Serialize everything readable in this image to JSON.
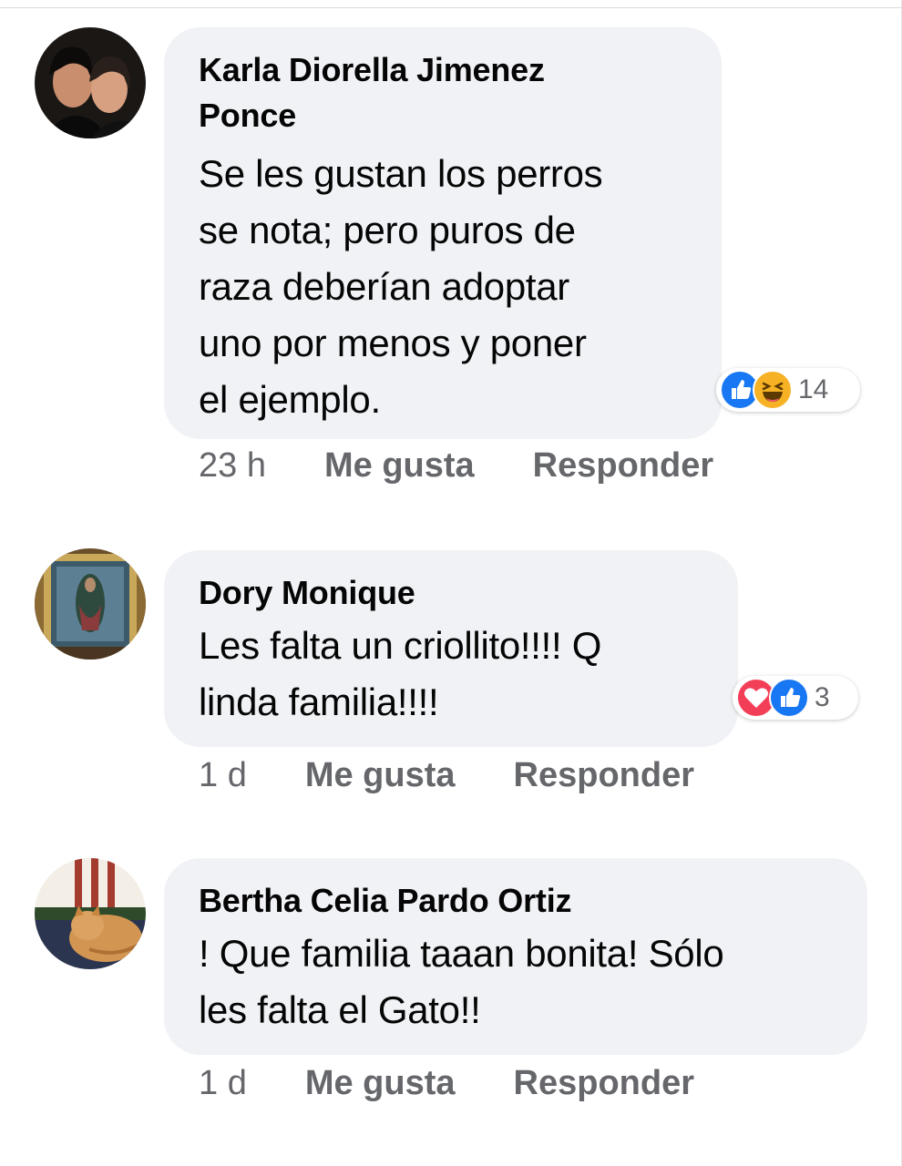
{
  "comments": [
    {
      "author": "Karla Diorella Jimenez Ponce",
      "author_line1": "Karla Diorella Jimenez",
      "author_line2": "Ponce",
      "text_lines": [
        "Se les gustan los perros",
        "se nota; pero puros de",
        "raza deberían adoptar",
        "uno por menos y poner",
        "el ejemplo."
      ],
      "reactions": [
        "like-icon",
        "haha-icon"
      ],
      "reaction_count": "14",
      "time": "23 h",
      "like_label": "Me gusta",
      "reply_label": "Responder"
    },
    {
      "author": "Dory Monique",
      "text_lines": [
        "Les falta un criollito!!!! Q",
        "linda familia!!!!"
      ],
      "reactions": [
        "love-icon",
        "like-icon"
      ],
      "reaction_count": "3",
      "time": "1 d",
      "like_label": "Me gusta",
      "reply_label": "Responder"
    },
    {
      "author": "Bertha Celia Pardo Ortiz",
      "text_lines": [
        "! Que familia taaan bonita! Sólo",
        "les falta el Gato!!"
      ],
      "time": "1 d",
      "like_label": "Me gusta",
      "reply_label": "Responder"
    }
  ],
  "colors": {
    "bubble": "#f0f2f5",
    "secondary_text": "#65676b",
    "like_blue": "#1877f2",
    "love_red": "#f33e58",
    "haha_yellow": "#f7b125"
  }
}
